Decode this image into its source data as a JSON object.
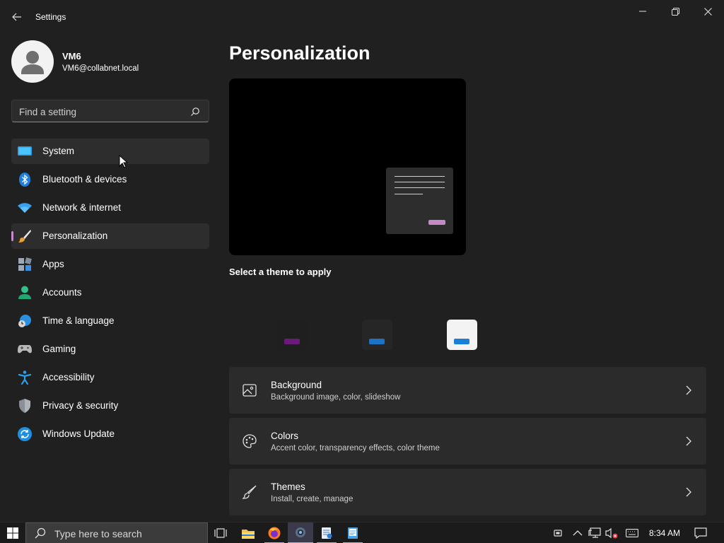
{
  "titlebar": {
    "title": "Settings",
    "back_icon": "back-arrow-icon",
    "controls": [
      "minimize-icon",
      "restore-icon",
      "close-icon"
    ]
  },
  "profile": {
    "name": "VM6",
    "email": "VM6@collabnet.local"
  },
  "search": {
    "placeholder": "Find a setting",
    "value": ""
  },
  "sidebar": {
    "items": [
      {
        "label": "System",
        "icon": "system-display-icon",
        "state": "hover"
      },
      {
        "label": "Bluetooth & devices",
        "icon": "bluetooth-icon",
        "state": ""
      },
      {
        "label": "Network & internet",
        "icon": "wifi-icon",
        "state": ""
      },
      {
        "label": "Personalization",
        "icon": "paintbrush-icon",
        "state": "selected"
      },
      {
        "label": "Apps",
        "icon": "apps-icon",
        "state": ""
      },
      {
        "label": "Accounts",
        "icon": "accounts-icon",
        "state": ""
      },
      {
        "label": "Time & language",
        "icon": "globe-clock-icon",
        "state": ""
      },
      {
        "label": "Gaming",
        "icon": "gamepad-icon",
        "state": ""
      },
      {
        "label": "Accessibility",
        "icon": "accessibility-icon",
        "state": ""
      },
      {
        "label": "Privacy & security",
        "icon": "shield-icon",
        "state": ""
      },
      {
        "label": "Windows Update",
        "icon": "update-icon",
        "state": ""
      }
    ]
  },
  "main": {
    "title": "Personalization",
    "select_theme_label": "Select a theme to apply",
    "themes": [
      {
        "bg": "#1f1f1f",
        "accent": "#6a1b7a"
      },
      {
        "bg": "#262626",
        "accent": "#1a73c7"
      },
      {
        "bg": "#f3f3f3",
        "accent": "#1a7fd6"
      }
    ],
    "cards": [
      {
        "title": "Background",
        "subtitle": "Background image, color, slideshow",
        "icon": "image-icon"
      },
      {
        "title": "Colors",
        "subtitle": "Accent color, transparency effects, color theme",
        "icon": "palette-icon"
      },
      {
        "title": "Themes",
        "subtitle": "Install, create, manage",
        "icon": "brush-icon"
      }
    ]
  },
  "taskbar": {
    "search_placeholder": "Type here to search",
    "apps": [
      "task-view-icon",
      "file-explorer-icon",
      "firefox-icon",
      "settings-app-icon",
      "notepad-icon",
      "document-app-icon"
    ],
    "tray": [
      "meet-now-icon",
      "chevron-up-icon",
      "network-icon",
      "volume-muted-icon",
      "keyboard-icon"
    ],
    "time": "8:34 AM",
    "notification_icon": "notification-icon"
  },
  "colors": {
    "accent": "#c48ac9",
    "background": "#202020",
    "card": "#2b2b2b"
  }
}
